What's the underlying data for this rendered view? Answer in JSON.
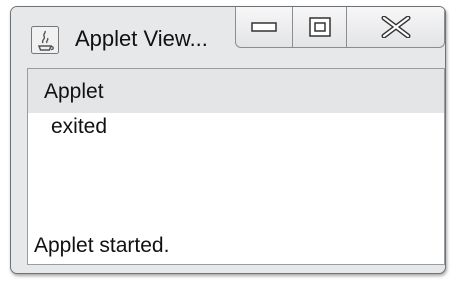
{
  "window": {
    "title": "Applet View...",
    "icon": "java-coffee-cup-icon",
    "controls": {
      "minimize": "minimize-icon",
      "maximize": "maximize-icon",
      "close": "close-icon"
    }
  },
  "applet": {
    "lines": [
      "Applet",
      "exited"
    ],
    "status": "Applet started."
  },
  "colors": {
    "frame": "#e7e8ea",
    "content_bg": "#ffffff",
    "highlight_row": "#e4e5e7"
  }
}
